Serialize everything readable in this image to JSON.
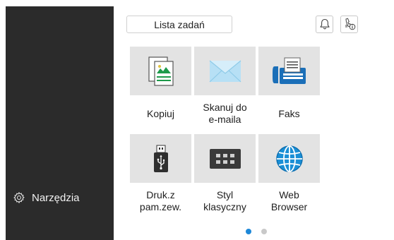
{
  "sidebar": {
    "tools_label": "Narzędzia"
  },
  "header": {
    "jobs_label": "Lista zadań"
  },
  "tiles": [
    {
      "label": "Kopiuj"
    },
    {
      "label": "Skanuj do\ne-maila"
    },
    {
      "label": "Faks"
    },
    {
      "label": "Druk.z\npam.zew."
    },
    {
      "label": "Styl\nklasyczny"
    },
    {
      "label": "Web\nBrowser"
    }
  ],
  "pager": {
    "current_page": 1,
    "total_pages": 2
  },
  "colors": {
    "sidebar": "#2b2b2b",
    "tile": "#e3e3e3",
    "accent": "#1e88d8"
  }
}
